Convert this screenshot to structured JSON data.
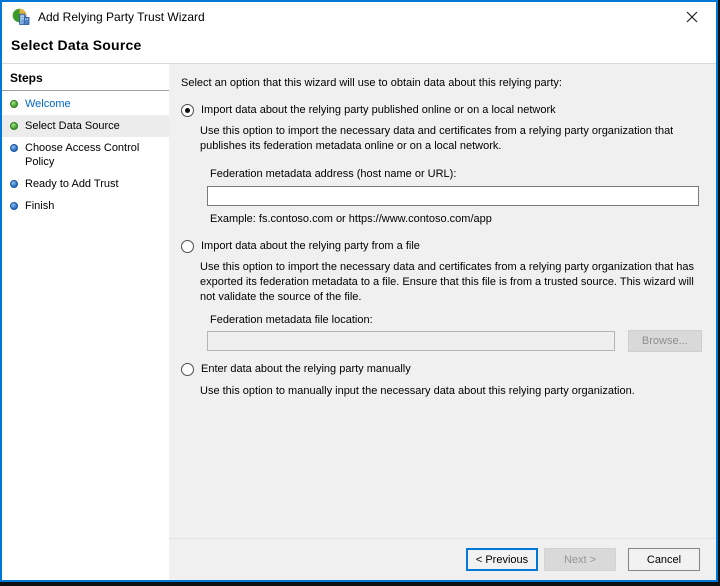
{
  "window": {
    "title": "Add Relying Party Trust Wizard"
  },
  "page": {
    "heading": "Select Data Source"
  },
  "sidebar": {
    "heading": "Steps",
    "items": [
      {
        "label": "Welcome",
        "bullet": "green",
        "state": "completed-link"
      },
      {
        "label": "Select Data Source",
        "bullet": "green",
        "state": "current"
      },
      {
        "label": "Choose Access Control Policy",
        "bullet": "blue",
        "state": "upcoming"
      },
      {
        "label": "Ready to Add Trust",
        "bullet": "blue",
        "state": "upcoming"
      },
      {
        "label": "Finish",
        "bullet": "blue",
        "state": "upcoming"
      }
    ]
  },
  "main": {
    "intro": "Select an option that this wizard will use to obtain data about this relying party:",
    "options": [
      {
        "label": "Import data about the relying party published online or on a local network",
        "selected": true,
        "description": "Use this option to import the necessary data and certificates from a relying party organization that publishes its federation metadata online or on a local network.",
        "field_label": "Federation metadata address (host name or URL):",
        "field_value": "",
        "example": "Example: fs.contoso.com or https://www.contoso.com/app"
      },
      {
        "label": "Import data about the relying party from a file",
        "selected": false,
        "description": "Use this option to import the necessary data and certificates from a relying party organization that has exported its federation metadata to a file. Ensure that this file is from a trusted source.  This wizard will not validate the source of the file.",
        "field_label": "Federation metadata file location:",
        "field_value": "",
        "field_disabled": true,
        "browse_label": "Browse...",
        "browse_disabled": true
      },
      {
        "label": "Enter data about the relying party manually",
        "selected": false,
        "description": "Use this option to manually input the necessary data about this relying party organization."
      }
    ]
  },
  "footer": {
    "previous_label": "< Previous",
    "next_label": "Next >",
    "next_disabled": true,
    "cancel_label": "Cancel"
  },
  "colors": {
    "accent_border": "#0078d7",
    "panel": "#f0f0f0",
    "sidebar_highlight": "#ececec",
    "link_blue": "#0066cc",
    "step_done_green": "#3c9b28",
    "step_todo_blue": "#1d66b8",
    "disabled_button_face": "#d9d9d9"
  }
}
